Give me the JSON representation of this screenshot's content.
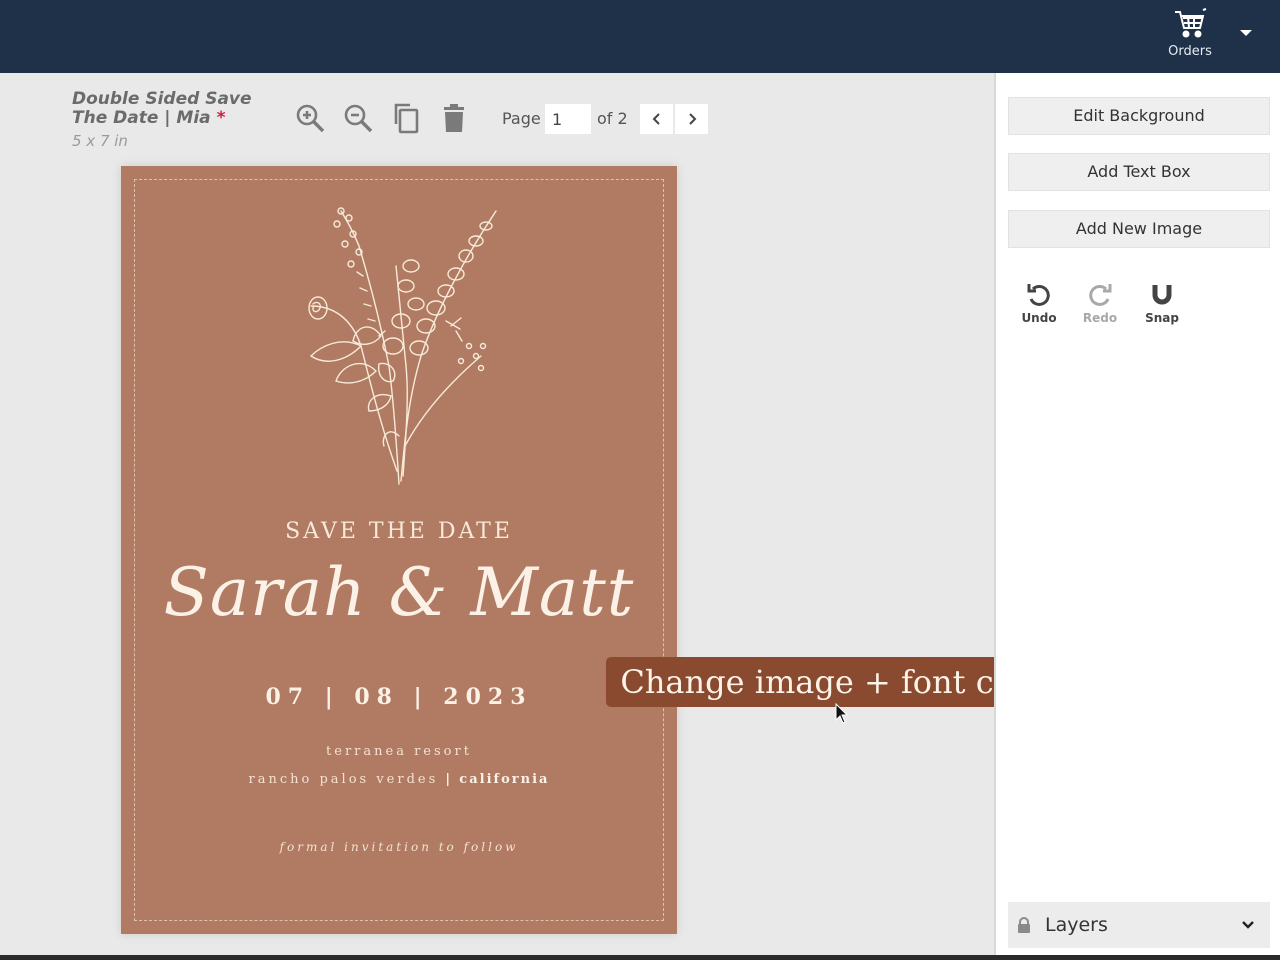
{
  "header": {
    "orders_label": "Orders",
    "orders_icon": "cart-icon",
    "menu_icon": "caret-down-icon"
  },
  "document": {
    "title": "Double Sided Save The Date | Mia",
    "unsaved_marker": "*",
    "size": "5 x 7 in"
  },
  "toolbar": {
    "tools": [
      {
        "name": "zoom-in",
        "icon": "zoom-in-icon"
      },
      {
        "name": "zoom-out",
        "icon": "zoom-out-icon"
      },
      {
        "name": "duplicate",
        "icon": "copy-icon"
      },
      {
        "name": "delete",
        "icon": "trash-icon"
      }
    ],
    "page_label": "Page",
    "page_value": "1",
    "page_of": "of 2",
    "prev_icon": "chevron-left-icon",
    "next_icon": "chevron-right-icon"
  },
  "card": {
    "background_color": "#b07b62",
    "illustration": "floral-bouquet",
    "headline": "SAVE THE DATE",
    "names": "Sarah & Matt",
    "date": "07 | 08 | 2023",
    "venue": "terranea resort",
    "city": "rancho palos verdes",
    "separator": "|",
    "state": "california",
    "footer": "formal invitation to follow"
  },
  "caption": {
    "text": "Change image + font color",
    "color": "#8a4a2f"
  },
  "sidebar": {
    "buttons": [
      {
        "label": "Edit Background"
      },
      {
        "label": "Add Text Box"
      },
      {
        "label": "Add New Image"
      }
    ],
    "history": [
      {
        "label": "Undo",
        "icon": "undo-icon",
        "enabled": true
      },
      {
        "label": "Redo",
        "icon": "redo-icon",
        "enabled": false
      },
      {
        "label": "Snap",
        "icon": "magnet-icon",
        "enabled": true
      }
    ],
    "layers_label": "Layers"
  },
  "colors": {
    "header_bg": "#1f3049",
    "card_bg": "#b07b62",
    "caption_bg": "#8a4a2f",
    "unsaved_star": "#d0204a"
  }
}
